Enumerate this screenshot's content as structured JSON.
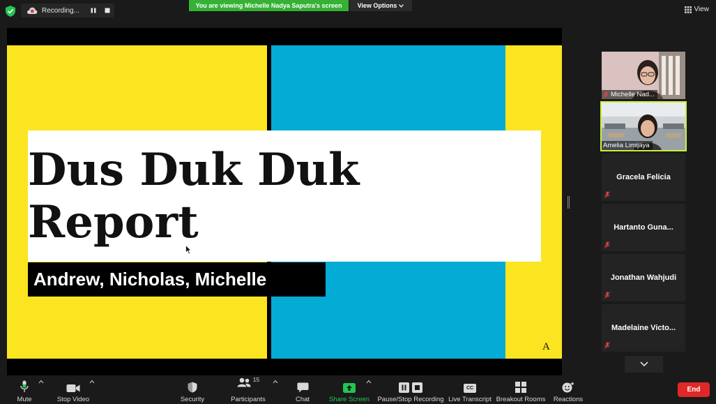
{
  "top": {
    "recording_label": "Recording...",
    "viewing_banner": "You are viewing Michelle Nadya Saputra's screen",
    "view_options": "View Options",
    "view_label": "View"
  },
  "slide": {
    "title": "Dus Duk Duk Report",
    "names": "Andrew, Nicholas, Michelle",
    "corner_mark": "A"
  },
  "participants": {
    "video": [
      {
        "name": "Michelle Nad..."
      },
      {
        "name": "Amelia Limijaya"
      }
    ],
    "tiles": [
      {
        "name": "Gracela Felicia"
      },
      {
        "name": "Hartanto  Guna..."
      },
      {
        "name": "Jonathan Wahjudi"
      },
      {
        "name": "Madelaine  Victo..."
      }
    ]
  },
  "toolbar": {
    "mute": "Mute",
    "stop_video": "Stop Video",
    "security": "Security",
    "participants": "Participants",
    "participants_count": "15",
    "chat": "Chat",
    "share_screen": "Share Screen",
    "pause_stop_recording": "Pause/Stop Recording",
    "live_transcript": "Live Transcript",
    "cc_badge": "CC",
    "breakout_rooms": "Breakout Rooms",
    "reactions": "Reactions",
    "end": "End"
  },
  "colors": {
    "accent_green": "#35b135",
    "end_red": "#e02828",
    "slide_yellow": "#fbe520",
    "slide_blue": "#04abd4",
    "active_speaker": "#c9f23a"
  }
}
